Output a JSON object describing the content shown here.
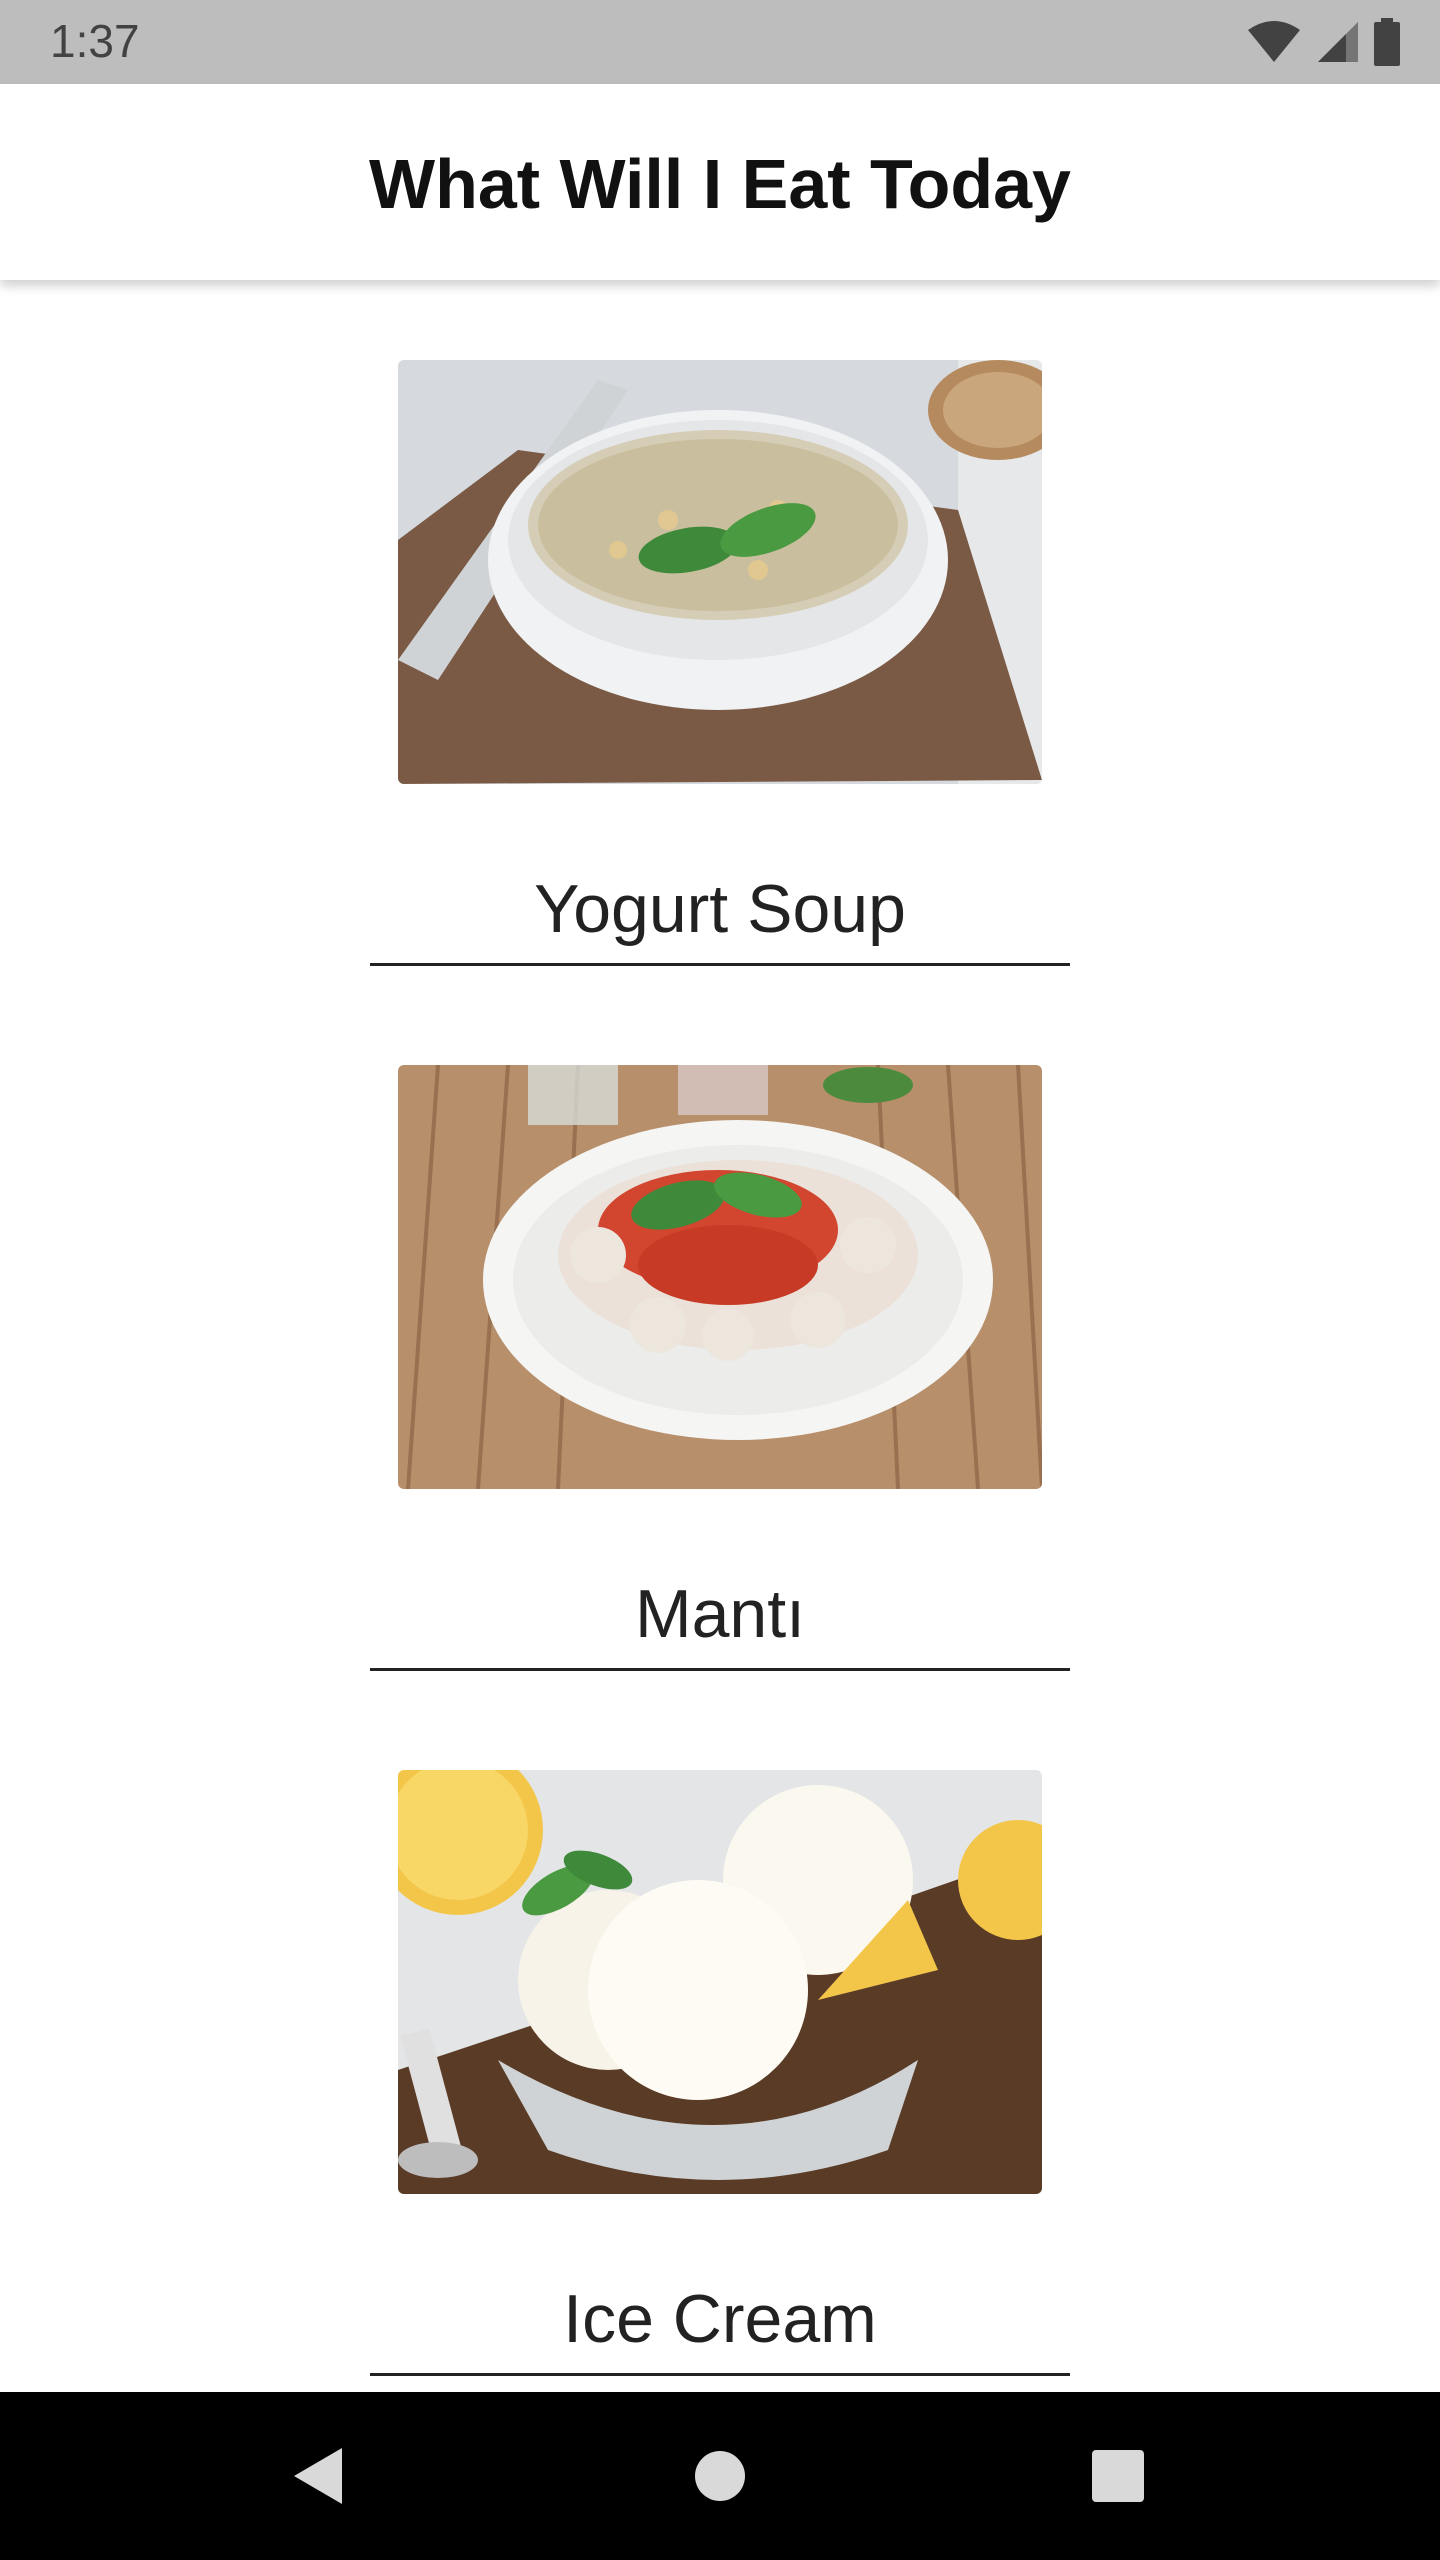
{
  "status_bar": {
    "time": "1:37",
    "icons": [
      "wifi-icon",
      "cell-signal-icon",
      "battery-icon"
    ]
  },
  "app_bar": {
    "title": "What Will I Eat Today"
  },
  "foods": [
    {
      "name": "Yogurt Soup",
      "image": "yogurt-soup-photo"
    },
    {
      "name": "Mantı",
      "image": "manti-photo"
    },
    {
      "name": "Ice Cream",
      "image": "ice-cream-photo"
    }
  ],
  "nav_bar": {
    "buttons": [
      "back-icon",
      "home-icon",
      "recents-icon"
    ]
  }
}
